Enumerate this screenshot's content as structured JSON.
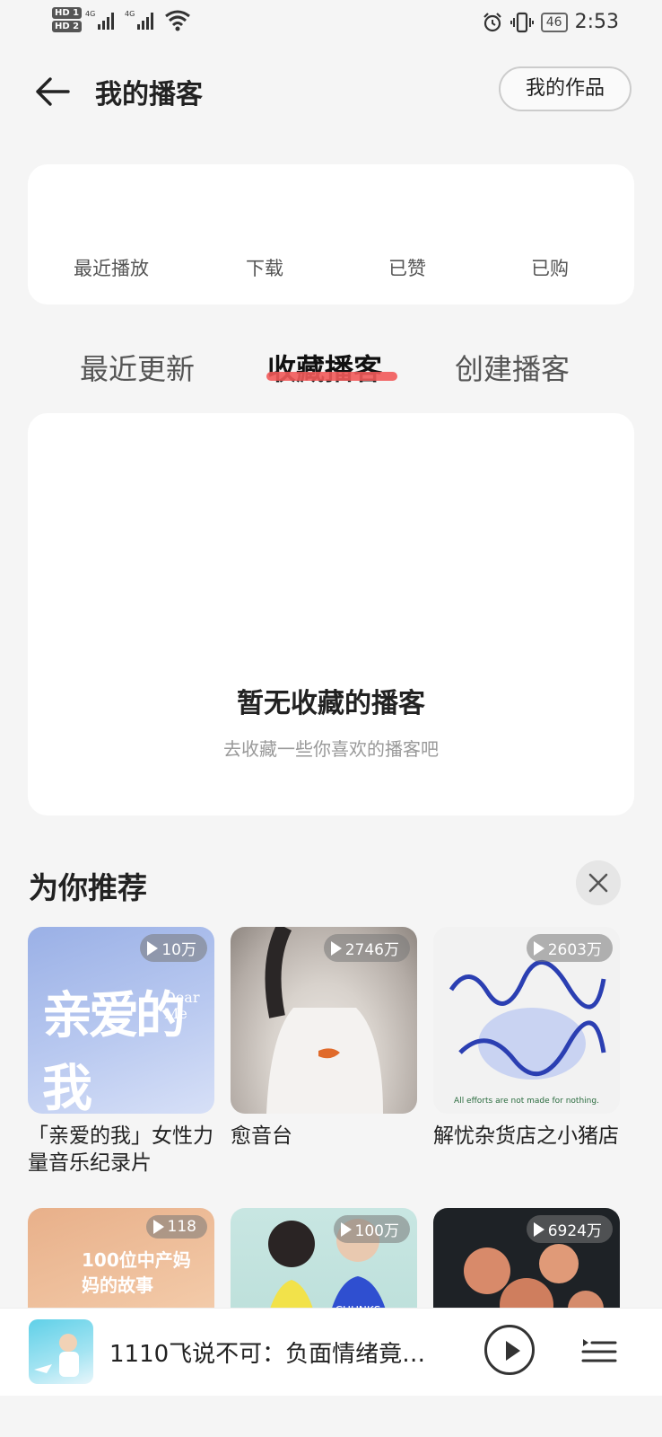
{
  "status_bar": {
    "sim1": "HD 1",
    "sim2": "HD 2",
    "net1": "4G",
    "net2": "4G",
    "battery": "46",
    "time": "2:53"
  },
  "header": {
    "title": "我的播客",
    "works_button": "我的作品"
  },
  "quick_links": [
    "最近播放",
    "下载",
    "已赞",
    "已购"
  ],
  "tabs": {
    "items": [
      "最近更新",
      "收藏播客",
      "创建播客"
    ],
    "active": "收藏播客"
  },
  "empty_state": {
    "title": "暂无收藏的播客",
    "subtitle": "去收藏一些你喜欢的播客吧"
  },
  "recommend": {
    "title": "为你推荐",
    "items": [
      {
        "title": "「亲爱的我」女性力量音乐纪录片",
        "plays": "10万",
        "cover_text": "亲爱的我",
        "cover_sub": "Dear Me"
      },
      {
        "title": "愈音台",
        "plays": "2746万"
      },
      {
        "title": "解忧杂货店之小猪店",
        "plays": "2603万",
        "cover_caption": "All efforts are not made for nothing."
      },
      {
        "title": "",
        "plays": "118",
        "cover_text": "100位中产妈妈的故事"
      },
      {
        "title": "",
        "plays": "100万",
        "cover_text": "CHUNKS"
      },
      {
        "title": "",
        "plays": "6924万"
      }
    ]
  },
  "mini_player": {
    "title": "1110飞说不可：负面情绪竟…"
  },
  "colors": {
    "accent": "#f25a5a",
    "background": "#f5f5f5"
  }
}
